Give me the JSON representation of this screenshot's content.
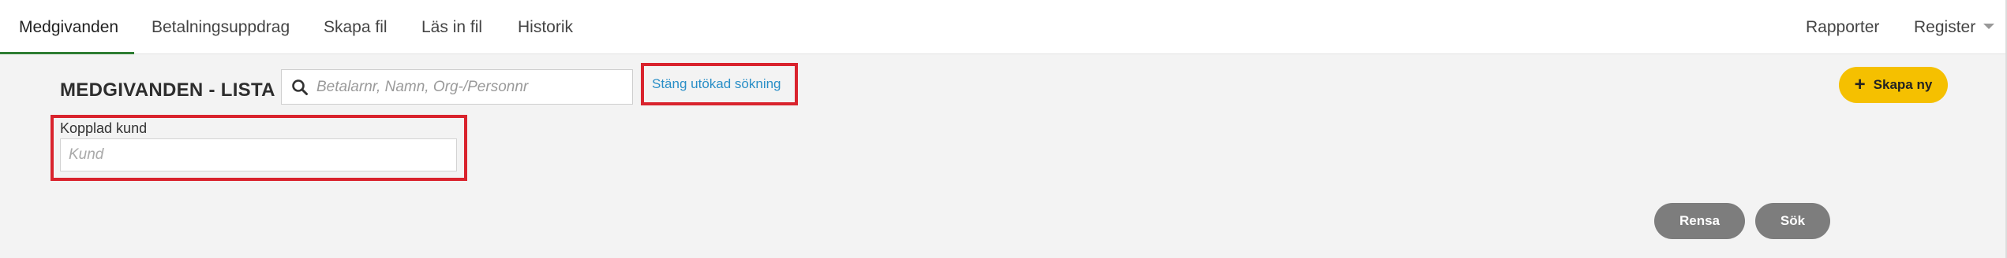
{
  "nav": {
    "tabs": [
      {
        "label": "Medgivanden"
      },
      {
        "label": "Betalningsuppdrag"
      },
      {
        "label": "Skapa fil"
      },
      {
        "label": "Läs in fil"
      },
      {
        "label": "Historik"
      }
    ],
    "right_items": [
      {
        "label": "Rapporter"
      },
      {
        "label": "Register"
      }
    ]
  },
  "main": {
    "title": "MEDGIVANDEN - LISTA",
    "search": {
      "placeholder": "Betalarnr, Namn, Org-/Personnr",
      "value": ""
    },
    "toggle_extended_label": "Stäng utökad sökning",
    "create_label": "Skapa ny",
    "linked_customer": {
      "label": "Kopplad kund",
      "placeholder": "Kund",
      "value": ""
    },
    "clear_label": "Rensa",
    "search_label": "Sök"
  },
  "colors": {
    "accent_active_tab": "#2e7d32",
    "primary_button": "#f5c000",
    "secondary_button": "#7d7d7d",
    "link": "#2a8fc7",
    "highlight": "#d9232d"
  },
  "icons": [
    "search-icon",
    "plus-icon",
    "chevron-down-icon"
  ]
}
